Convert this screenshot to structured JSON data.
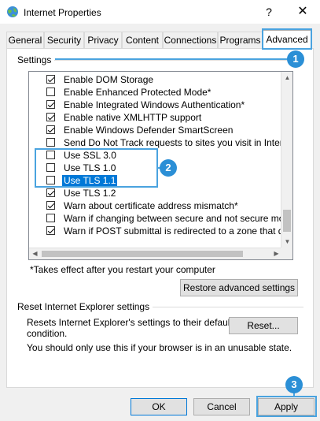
{
  "window": {
    "title": "Internet Properties",
    "help_label": "?",
    "close_label": "✕",
    "icon": "internet-globe-icon"
  },
  "tabs": [
    {
      "label": "General"
    },
    {
      "label": "Security"
    },
    {
      "label": "Privacy"
    },
    {
      "label": "Content"
    },
    {
      "label": "Connections"
    },
    {
      "label": "Programs"
    },
    {
      "label": "Advanced",
      "active": true
    }
  ],
  "settings": {
    "group_label": "Settings",
    "items": [
      {
        "label": "Enable DOM Storage",
        "checked": true
      },
      {
        "label": "Enable Enhanced Protected Mode*",
        "checked": false
      },
      {
        "label": "Enable Integrated Windows Authentication*",
        "checked": true
      },
      {
        "label": "Enable native XMLHTTP support",
        "checked": true
      },
      {
        "label": "Enable Windows Defender SmartScreen",
        "checked": true
      },
      {
        "label": "Send Do Not Track requests to sites you visit in Internet E",
        "checked": false
      },
      {
        "label": "Use SSL 3.0",
        "checked": false
      },
      {
        "label": "Use TLS 1.0",
        "checked": false
      },
      {
        "label": "Use TLS 1.1",
        "checked": false,
        "selected": true
      },
      {
        "label": "Use TLS 1.2",
        "checked": true
      },
      {
        "label": "Warn about certificate address mismatch*",
        "checked": true
      },
      {
        "label": "Warn if changing between secure and not secure mode",
        "checked": false
      },
      {
        "label": "Warn if POST submittal is redirected to a zone that does n",
        "checked": true
      }
    ],
    "restart_note": "*Takes effect after you restart your computer",
    "restore_button": "Restore advanced settings"
  },
  "reset": {
    "group_label": "Reset Internet Explorer settings",
    "description_line1": "Resets Internet Explorer's settings to their default",
    "description_line2": "condition.",
    "reset_button": "Reset...",
    "warning": "You should only use this if your browser is in an unusable state."
  },
  "footer": {
    "ok": "OK",
    "cancel": "Cancel",
    "apply": "Apply"
  },
  "callouts": [
    "1",
    "2",
    "3"
  ],
  "colors": {
    "accent": "#4aa3df",
    "selection": "#0078d7"
  }
}
